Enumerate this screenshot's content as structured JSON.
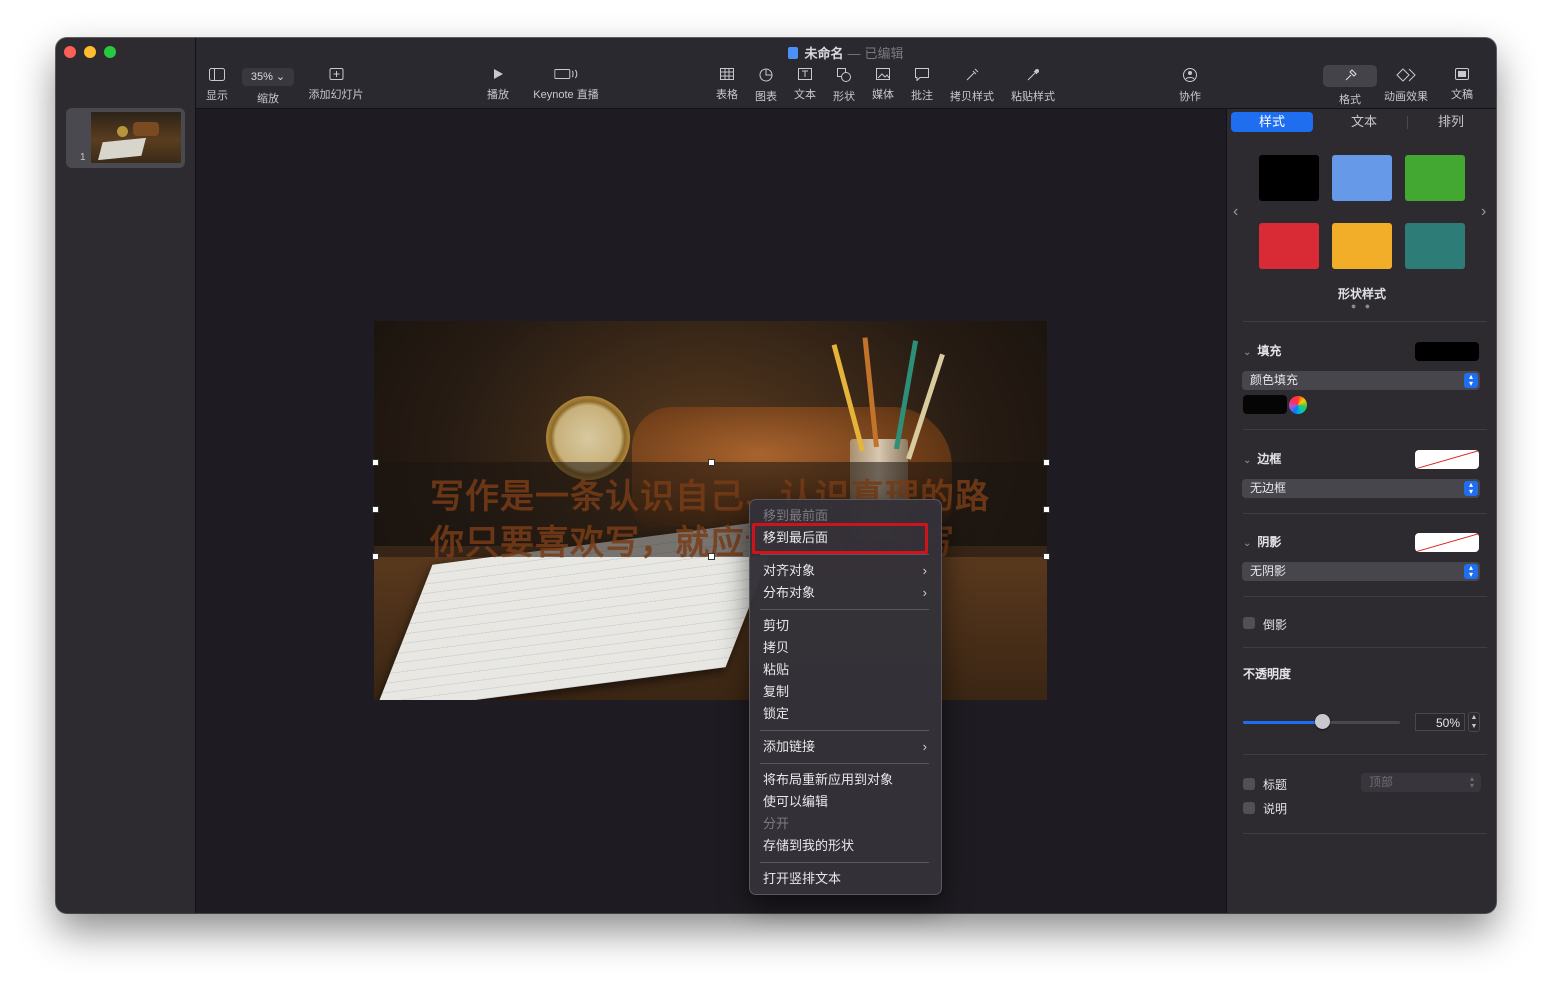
{
  "window": {
    "doc_title": "未命名",
    "doc_status": "已编辑"
  },
  "toolbar": {
    "view": "显示",
    "zoom_value": "35%",
    "zoom": "缩放",
    "add_slide": "添加幻灯片",
    "play": "播放",
    "keynote_live": "Keynote 直播",
    "table": "表格",
    "chart": "图表",
    "text": "文本",
    "shape": "形状",
    "media": "媒体",
    "comment": "批注",
    "copy_style": "拷贝样式",
    "paste_style": "粘贴样式",
    "collaborate": "协作",
    "format": "格式",
    "animate": "动画效果",
    "document": "文稿"
  },
  "navigator": {
    "slide_number": "1"
  },
  "slide": {
    "line1": "写作是一条认识自己、认识真理的路",
    "line2": "你只要喜欢写，就应该勇敢地去写"
  },
  "context_menu": {
    "items": [
      {
        "label": "移到最前面",
        "disabled": true
      },
      {
        "label": "移到最后面",
        "highlighted": true
      },
      {
        "label": "对齐对象",
        "submenu": true
      },
      {
        "label": "分布对象",
        "submenu": true
      },
      {
        "label": "剪切"
      },
      {
        "label": "拷贝"
      },
      {
        "label": "粘贴"
      },
      {
        "label": "复制"
      },
      {
        "label": "锁定"
      },
      {
        "label": "添加链接",
        "submenu": true
      },
      {
        "label": "将布局重新应用到对象"
      },
      {
        "label": "使可以编辑"
      },
      {
        "label": "分开",
        "disabled": true
      },
      {
        "label": "存储到我的形状"
      },
      {
        "label": "打开竖排文本"
      }
    ]
  },
  "inspector": {
    "tabs": [
      "样式",
      "文本",
      "排列"
    ],
    "swatch_colors": [
      "#000000",
      "#6699e8",
      "#42a832",
      "#d92b36",
      "#f2ae28",
      "#2e7c78"
    ],
    "shape_styles_caption": "形状样式",
    "fill": {
      "title": "填充",
      "popup": "颜色填充",
      "color": "#000000"
    },
    "border": {
      "title": "边框",
      "popup": "无边框"
    },
    "shadow": {
      "title": "阴影",
      "popup": "无阴影"
    },
    "reflection": "倒影",
    "opacity": {
      "title": "不透明度",
      "value_text": "50%",
      "value": 0.5
    },
    "title_checkbox": "标题",
    "title_position": "顶部",
    "caption_checkbox": "说明"
  },
  "colors": {
    "accent": "#1f6ef0",
    "menu_highlight_outline": "#d0131b"
  }
}
